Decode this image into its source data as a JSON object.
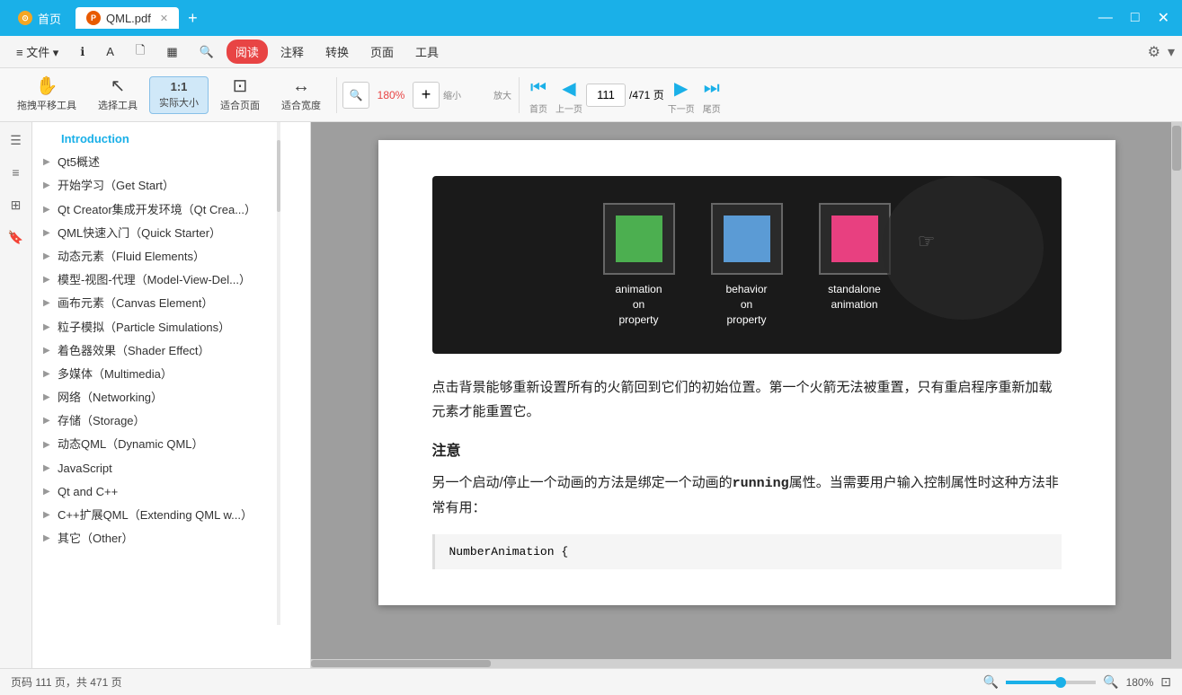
{
  "titlebar": {
    "home_tab": "首页",
    "pdf_tab": "QML.pdf",
    "add_tab": "+",
    "controls": [
      "—",
      "□",
      "✕"
    ]
  },
  "menubar": {
    "items": [
      {
        "id": "file",
        "label": "≡ 文件 ▾"
      },
      {
        "id": "info",
        "label": "ℹ"
      },
      {
        "id": "font",
        "label": "A"
      },
      {
        "id": "page",
        "label": "🗋"
      },
      {
        "id": "grid",
        "label": "▦"
      },
      {
        "id": "search",
        "label": "🔍"
      },
      {
        "id": "read",
        "label": "阅读",
        "active": true
      },
      {
        "id": "comment",
        "label": "注释"
      },
      {
        "id": "convert",
        "label": "转换"
      },
      {
        "id": "page2",
        "label": "页面"
      },
      {
        "id": "tools",
        "label": "工具"
      }
    ],
    "right": [
      "⚙",
      "▾"
    ]
  },
  "toolbar": {
    "tools": [
      {
        "id": "drag",
        "label": "拖拽平移工具",
        "icon": "✋"
      },
      {
        "id": "select",
        "label": "选择工具",
        "icon": "↖"
      },
      {
        "id": "actual",
        "label": "实际大小",
        "icon": "1:1",
        "active": true
      },
      {
        "id": "fit-page",
        "label": "适合页面",
        "icon": "⊡"
      },
      {
        "id": "fit-width",
        "label": "适合宽度",
        "icon": "↔"
      }
    ],
    "zoom": {
      "out_label": "缩小",
      "percent": "180%",
      "in_label": "放大"
    },
    "nav": {
      "first_label": "首页",
      "prev_label": "上一页",
      "current_page": "111",
      "total_pages": "/471 页",
      "next_label": "下一页",
      "last_label": "尾页"
    }
  },
  "toc": {
    "items": [
      {
        "id": "intro",
        "label": "Introduction",
        "active": true,
        "indent": 0
      },
      {
        "id": "qt5",
        "label": "Qt5概述",
        "indent": 1
      },
      {
        "id": "start",
        "label": "开始学习（Get Start）",
        "indent": 1
      },
      {
        "id": "qtcreator",
        "label": "Qt Creator集成开发环境（Qt Crea...）",
        "indent": 1
      },
      {
        "id": "quickstart",
        "label": "QML快速入门（Quick Starter）",
        "indent": 1
      },
      {
        "id": "fluid",
        "label": "动态元素（Fluid Elements）",
        "indent": 1
      },
      {
        "id": "modelview",
        "label": "模型-视图-代理（Model-View-Del...）",
        "indent": 1
      },
      {
        "id": "canvas",
        "label": "画布元素（Canvas Element）",
        "indent": 1
      },
      {
        "id": "particle",
        "label": "粒子模拟（Particle Simulations）",
        "indent": 1
      },
      {
        "id": "shader",
        "label": "着色器效果（Shader Effect）",
        "indent": 1
      },
      {
        "id": "multimedia",
        "label": "多媒体（Multimedia）",
        "indent": 1
      },
      {
        "id": "network",
        "label": "网络（Networking）",
        "indent": 1
      },
      {
        "id": "storage",
        "label": "存储（Storage）",
        "indent": 1
      },
      {
        "id": "dynamicqml",
        "label": "动态QML（Dynamic QML）",
        "indent": 1
      },
      {
        "id": "javascript",
        "label": "JavaScript",
        "indent": 1
      },
      {
        "id": "qtcpp",
        "label": "Qt and C++",
        "indent": 1
      },
      {
        "id": "extendqml",
        "label": "C++扩展QML（Extending QML w...）",
        "indent": 1
      },
      {
        "id": "other",
        "label": "其它（Other）",
        "indent": 1
      }
    ]
  },
  "pdf_content": {
    "image_labels": [
      {
        "label": "animation\non\nproperty"
      },
      {
        "label": "behavior\non\nproperty"
      },
      {
        "label": "standalone\nanimation"
      }
    ],
    "paragraph1": "点击背景能够重新设置所有的火箭回到它们的初始位置。第一个火箭无法被重置，只有重启程序重新加载元素才能重置它。",
    "notice_title": "注意",
    "paragraph2_start": "另一个启动/停止一个动画的方法是绑定一个动画的",
    "bold_word": "running",
    "paragraph2_end": "属性。当需要用户输入控制属性时这种方法非常有用：",
    "code_line": "NumberAnimation {"
  },
  "statusbar": {
    "text": "页码 111 页，共 471 页",
    "zoom_percent": "180%"
  }
}
